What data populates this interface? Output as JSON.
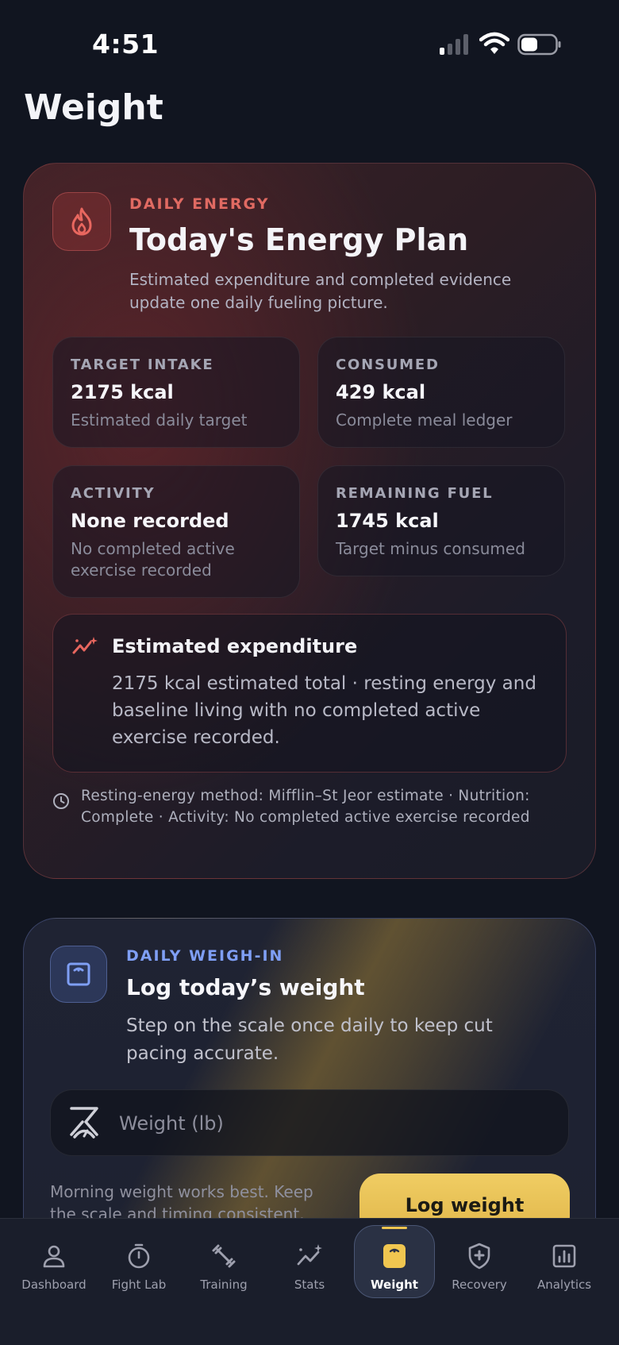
{
  "status_bar": {
    "time": "4:51"
  },
  "page": {
    "title": "Weight"
  },
  "energy_card": {
    "eyebrow": "DAILY ENERGY",
    "title": "Today's Energy Plan",
    "subtitle": "Estimated expenditure and completed evidence update one daily fueling picture.",
    "tiles": [
      {
        "label": "TARGET INTAKE",
        "value": "2175 kcal",
        "note": "Estimated daily target"
      },
      {
        "label": "CONSUMED",
        "value": "429 kcal",
        "note": "Complete meal ledger"
      },
      {
        "label": "ACTIVITY",
        "value": "None recorded",
        "note": "No completed active exercise recorded"
      },
      {
        "label": "REMAINING FUEL",
        "value": "1745 kcal",
        "note": "Target minus consumed"
      }
    ],
    "expenditure": {
      "title": "Estimated expenditure",
      "text": "2175 kcal estimated total · resting energy and baseline living with no completed active exercise recorded."
    },
    "method_note": "Resting-energy method: Mifflin–St Jeor estimate · Nutrition: Complete · Activity: No completed active exercise recorded"
  },
  "weigh_card": {
    "eyebrow": "DAILY WEIGH-IN",
    "title": "Log today’s weight",
    "subtitle": "Step on the scale once daily to keep cut pacing accurate.",
    "input_placeholder": "Weight (lb)",
    "hint": "Morning weight works best. Keep the scale and timing consistent.",
    "button_label": "Log weight"
  },
  "tab_bar": {
    "tabs": [
      {
        "label": "Dashboard",
        "icon": "person-icon"
      },
      {
        "label": "Fight Lab",
        "icon": "stopwatch-icon"
      },
      {
        "label": "Training",
        "icon": "dumbbell-icon"
      },
      {
        "label": "Stats",
        "icon": "sparkline-icon"
      },
      {
        "label": "Weight",
        "icon": "scale-icon",
        "active": true
      },
      {
        "label": "Recovery",
        "icon": "shield-plus-icon"
      },
      {
        "label": "Analytics",
        "icon": "bar-chart-icon"
      }
    ]
  },
  "colors": {
    "background": "#111520",
    "energy_accent": "#e06a62",
    "weigh_accent": "#7f9ff5",
    "button": "#e8c256",
    "active_tab_indicator": "#f0c650"
  }
}
